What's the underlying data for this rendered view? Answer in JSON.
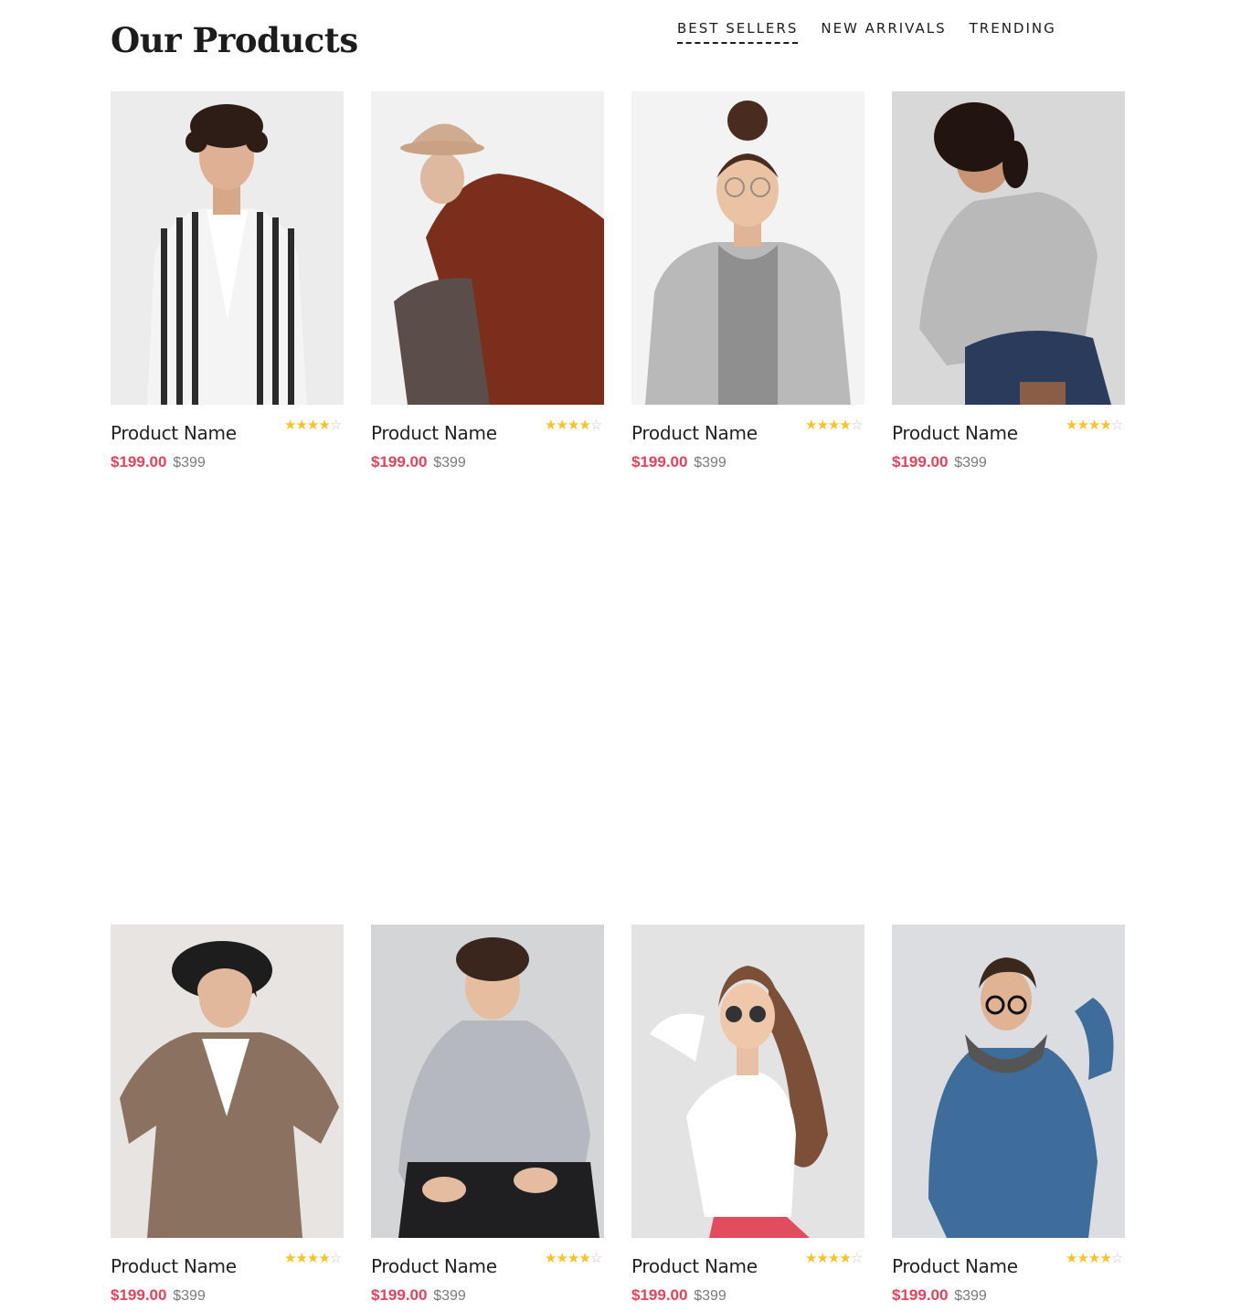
{
  "header": {
    "title": "Our Products",
    "tabs": [
      {
        "label": "BEST SELLERS",
        "active": true
      },
      {
        "label": "NEW ARRIVALS",
        "active": false
      },
      {
        "label": "TRENDING",
        "active": false
      }
    ]
  },
  "colors": {
    "price": "#e8415b",
    "old_price": "#7a7a7a",
    "star": "#f7c325"
  },
  "products": [
    {
      "name": "Product Name",
      "price": "$199.00",
      "old_price": "$399",
      "rating": 4,
      "max_rating": 5
    },
    {
      "name": "Product Name",
      "price": "$199.00",
      "old_price": "$399",
      "rating": 4,
      "max_rating": 5
    },
    {
      "name": "Product Name",
      "price": "$199.00",
      "old_price": "$399",
      "rating": 4,
      "max_rating": 5
    },
    {
      "name": "Product Name",
      "price": "$199.00",
      "old_price": "$399",
      "rating": 4,
      "max_rating": 5
    },
    {
      "name": "Product Name",
      "price": "$199.00",
      "old_price": "$399",
      "rating": 4,
      "max_rating": 5
    },
    {
      "name": "Product Name",
      "price": "$199.00",
      "old_price": "$399",
      "rating": 4,
      "max_rating": 5
    },
    {
      "name": "Product Name",
      "price": "$199.00",
      "old_price": "$399",
      "rating": 4,
      "max_rating": 5
    },
    {
      "name": "Product Name",
      "price": "$199.00",
      "old_price": "$399",
      "rating": 4,
      "max_rating": 5
    }
  ]
}
